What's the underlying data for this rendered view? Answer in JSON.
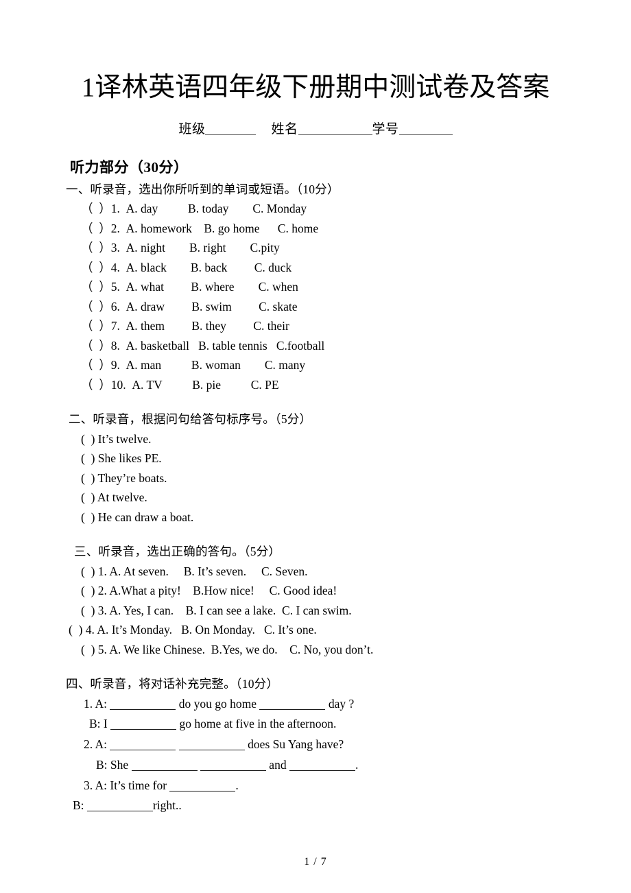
{
  "document": {
    "title": "1译林英语四年级下册期中测试卷及答案",
    "info_line": {
      "class_label": "班级",
      "name_label": "姓名",
      "student_no_label": "学号"
    },
    "part_heading": "听力部分（30分）",
    "footer": "1 / 7"
  },
  "sections": [
    {
      "heading": "一、听录音，选出你所听到的单词或短语。（10分）",
      "items": [
        "（  ）1.  A. day          B. today        C. Monday",
        "（  ）2.  A. homework    B. go home      C. home",
        "（  ）3.  A. night        B. right        C.pity",
        "（  ）4.  A. black        B. back         C. duck",
        "（  ）5.  A. what         B. where        C. when",
        "（  ）6.  A. draw         B. swim         C. skate",
        "（  ）7.  A. them         B. they         C. their",
        "（  ）8.  A. basketball   B. table tennis   C.football",
        "（  ）9.  A. man          B. woman        C. many",
        "（  ）10.  A. TV          B. pie          C. PE"
      ]
    },
    {
      "heading": "二、听录音，根据问句给答句标序号。（5分）",
      "items": [
        "(  ) It’s twelve.",
        "(  ) She likes PE.",
        "(  ) They’re boats.",
        "(  ) At twelve.",
        "(  ) He can draw a boat."
      ]
    },
    {
      "heading": "三、听录音，选出正确的答句。（5分）",
      "items": [
        "(  ) 1. A. At seven.     B. It’s seven.     C. Seven.",
        "(  ) 2. A.What a pity!    B.How nice!     C. Good idea!",
        "(  ) 3. A. Yes, I can.    B. I can see a lake.  C. I can swim.",
        "(  ) 4. A. It’s Monday.   B. On Monday.   C. It’s one.",
        "(  ) 5. A. We like Chinese.  B.Yes, we do.    C. No, you don’t."
      ]
    }
  ],
  "section_four": {
    "heading": "四、听录音，将对话补充完整。（10分）",
    "lines": [
      {
        "indent": "i-a",
        "parts": [
          "1. A: ",
          "BLANK",
          " do you go home ",
          "BLANK",
          " day ?"
        ]
      },
      {
        "indent": "i-b",
        "parts": [
          "B: I ",
          "BLANK",
          " go home at five in the afternoon."
        ]
      },
      {
        "indent": "i-a",
        "parts": [
          "2. A: ",
          "BLANK",
          " ",
          "BLANK",
          " does Su Yang have?"
        ]
      },
      {
        "indent": "i-b2",
        "parts": [
          "B: She ",
          "BLANK",
          " ",
          "BLANK",
          " and ",
          "BLANK",
          "."
        ]
      },
      {
        "indent": "i-c",
        "parts": [
          "3. A: It’s time for ",
          "BLANK",
          "."
        ]
      },
      {
        "indent": "i-d",
        "parts": [
          "B: ",
          "BLANK",
          "right.."
        ]
      }
    ]
  },
  "style": {
    "text_color": "#000000",
    "background": "#ffffff",
    "rule_color": "#1a1a1a"
  }
}
